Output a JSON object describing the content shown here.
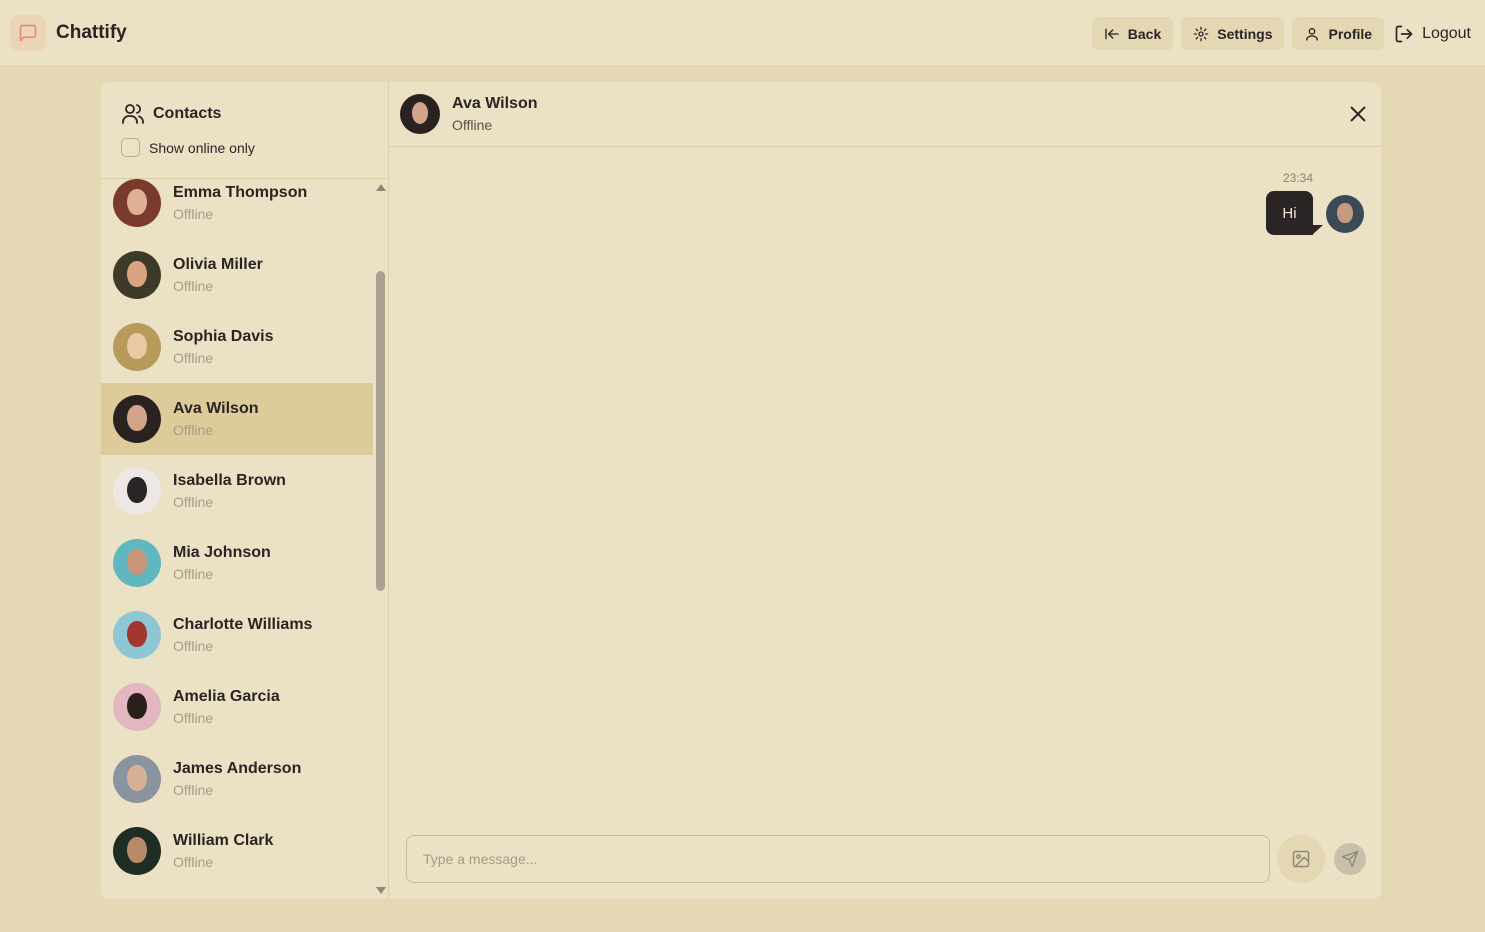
{
  "app": {
    "name": "Chattify",
    "logo_icon": "message-square-icon",
    "brand_accent": "#ecd4b6"
  },
  "nav": {
    "back_label": "Back",
    "settings_label": "Settings",
    "profile_label": "Profile",
    "logout_label": "Logout"
  },
  "sidebar": {
    "title": "Contacts",
    "online_filter_label": "Show online only",
    "online_filter_checked": false,
    "contacts": [
      {
        "name": "Emma Thompson",
        "status": "Offline",
        "avatar_color": "#7a3b2e",
        "face_color": "#e0b096"
      },
      {
        "name": "Olivia Miller",
        "status": "Offline",
        "avatar_color": "#3d3a2a",
        "face_color": "#d9a47f"
      },
      {
        "name": "Sophia Davis",
        "status": "Offline",
        "avatar_color": "#b89a5a",
        "face_color": "#eac8a3"
      },
      {
        "name": "Ava Wilson",
        "status": "Offline",
        "avatar_color": "#2a2220",
        "face_color": "#d2a58a",
        "active": true
      },
      {
        "name": "Isabella Brown",
        "status": "Offline",
        "avatar_color": "#ede8e6",
        "face_color": "#2a2424"
      },
      {
        "name": "Mia Johnson",
        "status": "Offline",
        "avatar_color": "#5fb8c0",
        "face_color": "#c99478"
      },
      {
        "name": "Charlotte Williams",
        "status": "Offline",
        "avatar_color": "#8ec6d6",
        "face_color": "#a3362e"
      },
      {
        "name": "Amelia Garcia",
        "status": "Offline",
        "avatar_color": "#e3b6c0",
        "face_color": "#2b1f1c"
      },
      {
        "name": "James Anderson",
        "status": "Offline",
        "avatar_color": "#8a93a0",
        "face_color": "#d7b196"
      },
      {
        "name": "William Clark",
        "status": "Offline",
        "avatar_color": "#1f2d24",
        "face_color": "#b98a6a"
      }
    ]
  },
  "chat": {
    "peer_name": "Ava Wilson",
    "peer_status": "Offline",
    "peer_avatar_color": "#2a2220",
    "peer_face_color": "#d2a58a",
    "messages": [
      {
        "time": "23:34",
        "text": "Hi",
        "from_me": true,
        "avatar_color": "#3b4a55",
        "face_color": "#c49a80"
      }
    ]
  },
  "composer": {
    "placeholder": "Type a message...",
    "value": "",
    "image_icon": "image-icon",
    "send_icon": "send-icon"
  }
}
